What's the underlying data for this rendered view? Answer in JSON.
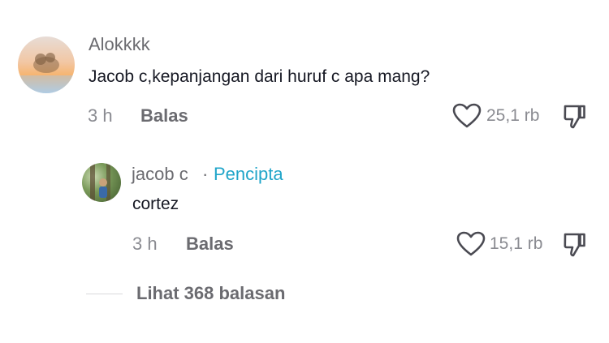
{
  "comment": {
    "author": "Alokkkk",
    "text": "Jacob c,kepanjangan dari huruf c apa mang?",
    "time": "3 h",
    "reply_label": "Balas",
    "likes": "25,1 rb",
    "icons": {
      "like": "heart-icon",
      "dislike": "thumbs-down-icon"
    }
  },
  "reply": {
    "author": "jacob c",
    "separator": "·",
    "badge": "Pencipta",
    "text": "cortez",
    "time": "3 h",
    "reply_label": "Balas",
    "likes": "15,1 rb",
    "icons": {
      "like": "heart-icon",
      "dislike": "thumbs-down-icon"
    }
  },
  "view_replies": {
    "label": "Lihat 368 balasan"
  },
  "colors": {
    "badge": "#20a5c9",
    "muted": "#8a8b91",
    "text": "#161823"
  }
}
